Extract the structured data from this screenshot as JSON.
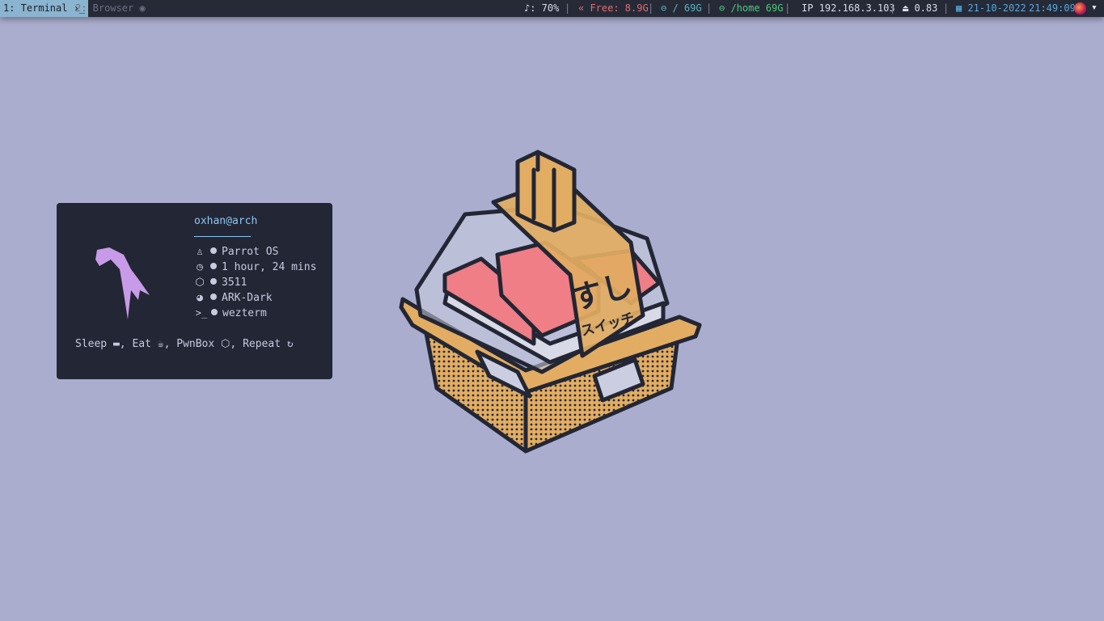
{
  "workspaces": [
    {
      "label": "1: Terminal ›_",
      "active": true
    },
    {
      "label": "2: Browser ◉",
      "active": false
    }
  ],
  "status": {
    "volume": "♪: 70%",
    "memory": "« Free: 8.9G",
    "root_disk": "⊖ / 69G",
    "home_disk": "⊖ /home 69G",
    "ip": "IP 192.168.3.103",
    "load": "⏏ 0.83",
    "date": "▦ 21-10-2022",
    "time": "21:49:09"
  },
  "colors": {
    "memory": "#e06c75",
    "disk_root": "#56b6c2",
    "disk_home": "#4ec97b",
    "date": "#56a8e0",
    "time": "#56a8e0"
  },
  "fetch": {
    "user": "oxhan@arch",
    "items": [
      {
        "icon": "linux-penguin-icon",
        "glyph": "♙",
        "value": "Parrot OS"
      },
      {
        "icon": "stopwatch-icon",
        "glyph": "◷",
        "value": "1 hour, 24 mins"
      },
      {
        "icon": "package-icon",
        "glyph": "⬡",
        "value": "3511"
      },
      {
        "icon": "palette-icon",
        "glyph": "◕",
        "value": "ARK-Dark"
      },
      {
        "icon": "terminal-prompt-icon",
        "glyph": ">_",
        "value": "wezterm"
      }
    ],
    "motto": [
      "Sleep",
      "Eat",
      "PwnBox",
      "Repeat"
    ]
  },
  "wallpaper": {
    "kanji": "すし",
    "katakana": "スイッチ"
  }
}
